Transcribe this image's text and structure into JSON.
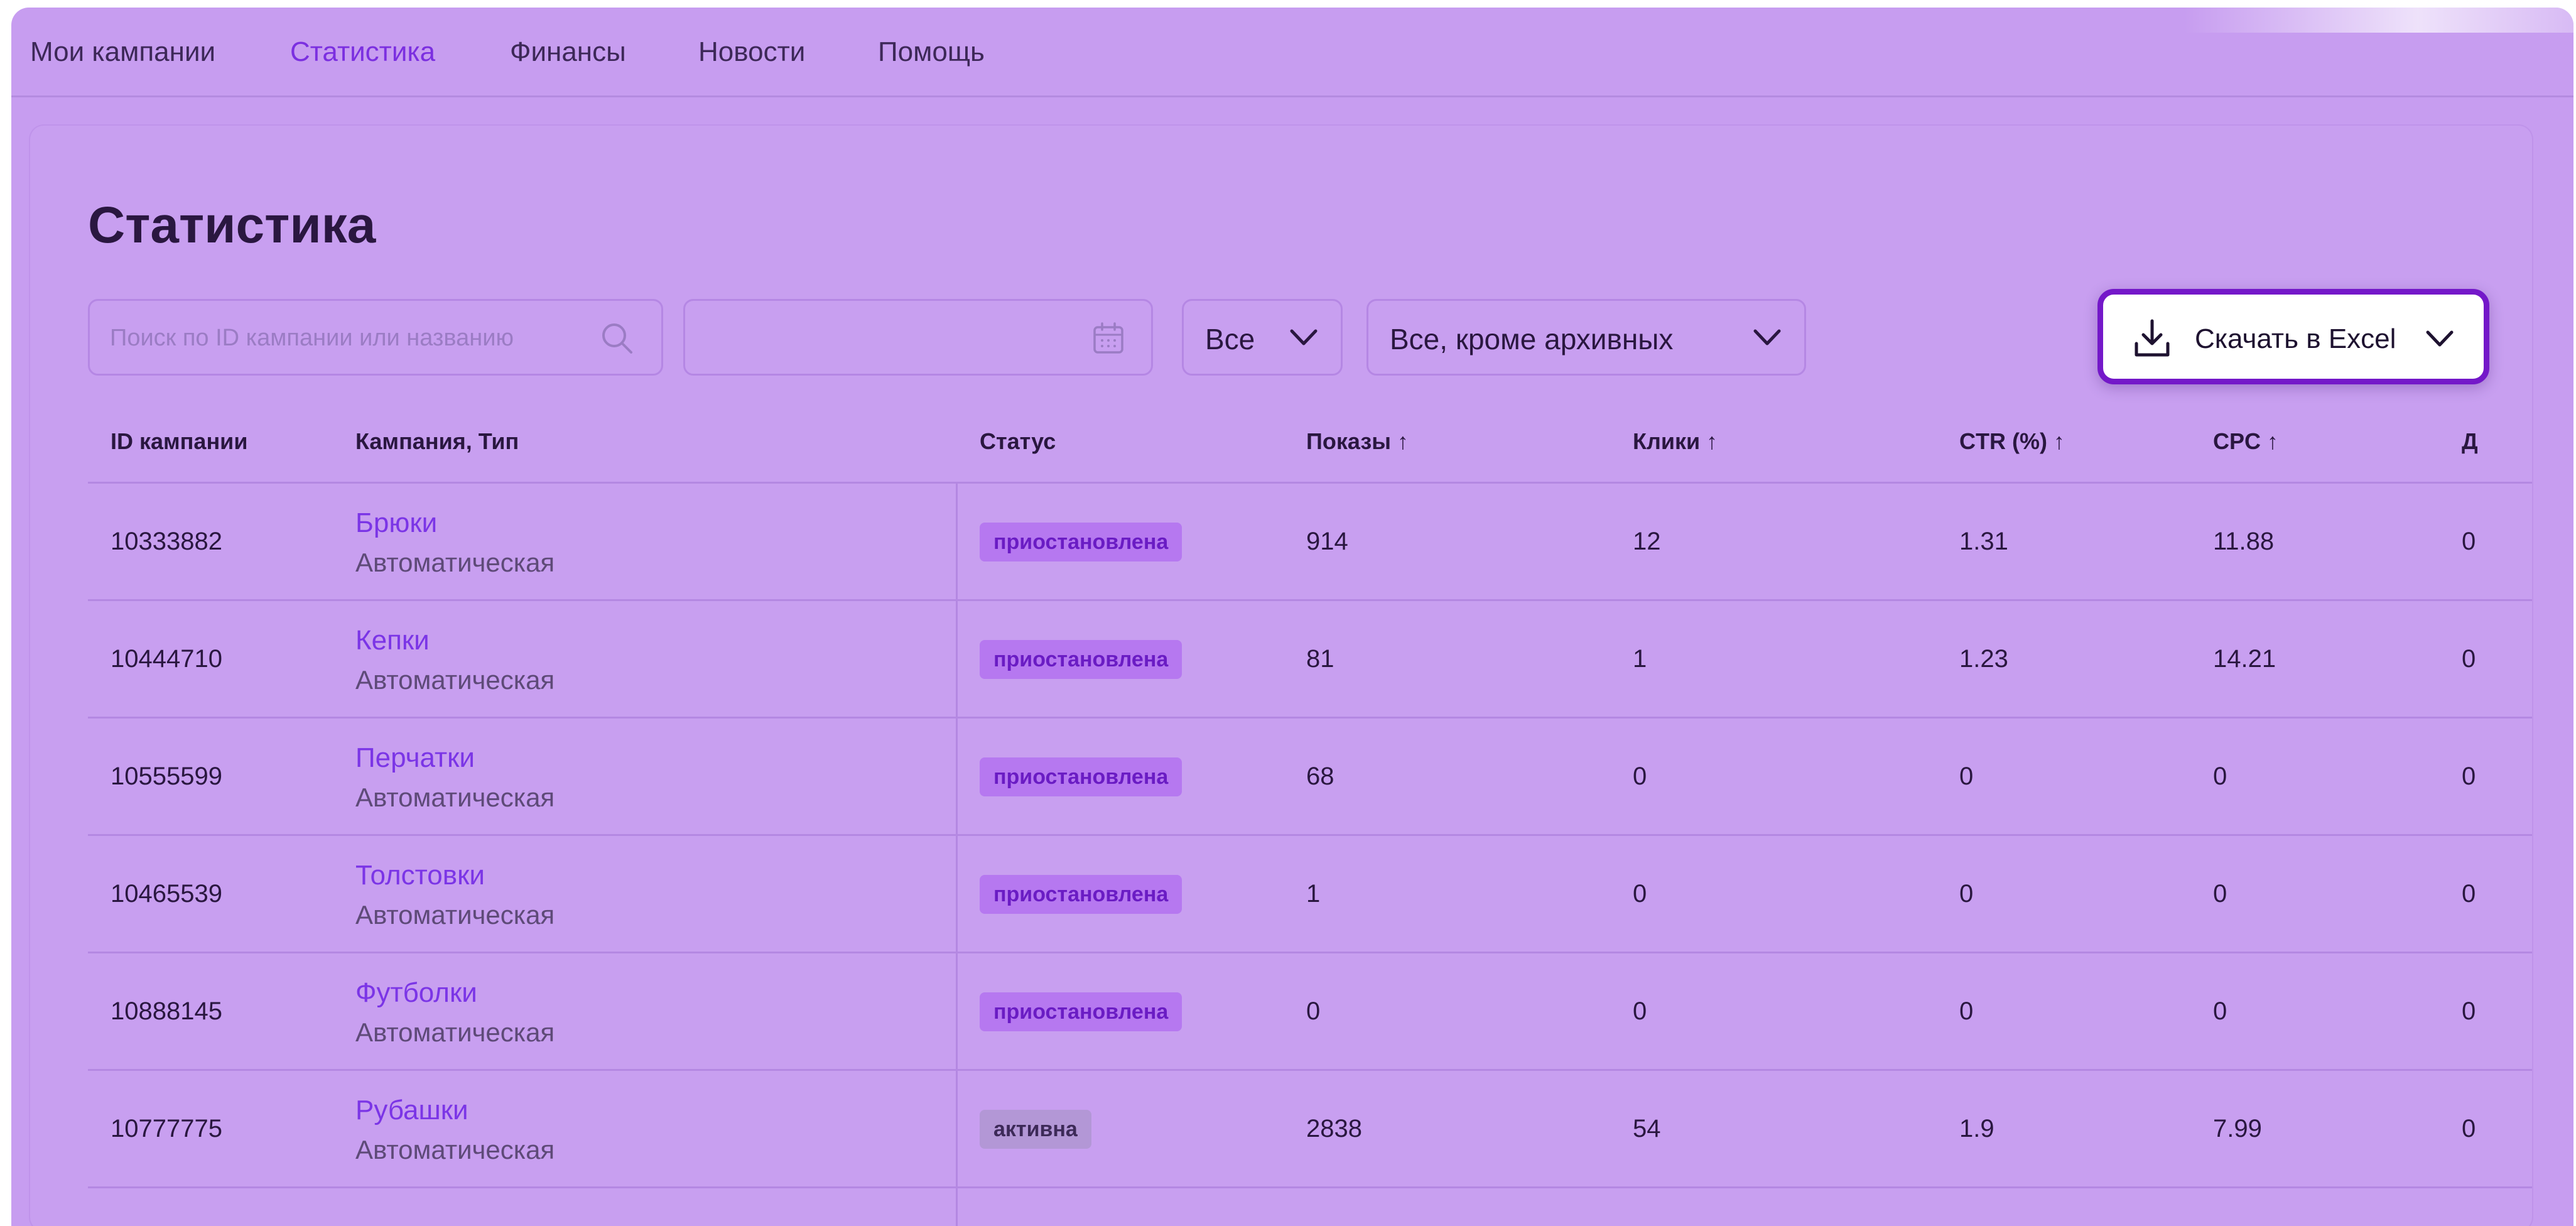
{
  "nav": {
    "items": [
      {
        "label": "Мои кампании",
        "active": false
      },
      {
        "label": "Статистика",
        "active": true
      },
      {
        "label": "Финансы",
        "active": false
      },
      {
        "label": "Новости",
        "active": false
      },
      {
        "label": "Помощь",
        "active": false
      }
    ]
  },
  "page": {
    "title": "Статистика"
  },
  "toolbar": {
    "search_placeholder": "Поиск по ID кампании или названию",
    "date_value": "",
    "type_filter": "Все",
    "status_filter": "Все, кроме архивных",
    "download_label": "Скачать в Excel"
  },
  "table": {
    "columns": [
      "ID кампании",
      "Кампания, Тип",
      "Статус",
      "Показы ↑",
      "Клики ↑",
      "CTR (%) ↑",
      "CPC ↑",
      "Д"
    ],
    "rows": [
      {
        "id": "10333882",
        "name": "Брюки",
        "type": "Автоматическая",
        "status": "приостановлена",
        "status_kind": "paused",
        "shows": "914",
        "clicks": "12",
        "ctr": "1.31",
        "cpc": "11.88",
        "extra": "0"
      },
      {
        "id": "10444710",
        "name": "Кепки",
        "type": "Автоматическая",
        "status": "приостановлена",
        "status_kind": "paused",
        "shows": "81",
        "clicks": "1",
        "ctr": "1.23",
        "cpc": "14.21",
        "extra": "0"
      },
      {
        "id": "10555599",
        "name": "Перчатки",
        "type": "Автоматическая",
        "status": "приостановлена",
        "status_kind": "paused",
        "shows": "68",
        "clicks": "0",
        "ctr": "0",
        "cpc": "0",
        "extra": "0"
      },
      {
        "id": "10465539",
        "name": "Толстовки",
        "type": "Автоматическая",
        "status": "приостановлена",
        "status_kind": "paused",
        "shows": "1",
        "clicks": "0",
        "ctr": "0",
        "cpc": "0",
        "extra": "0"
      },
      {
        "id": "10888145",
        "name": "Футболки",
        "type": "Автоматическая",
        "status": "приостановлена",
        "status_kind": "paused",
        "shows": "0",
        "clicks": "0",
        "ctr": "0",
        "cpc": "0",
        "extra": "0"
      },
      {
        "id": "10777775",
        "name": "Рубашки",
        "type": "Автоматическая",
        "status": "активна",
        "status_kind": "active",
        "shows": "2838",
        "clicks": "54",
        "ctr": "1.9",
        "cpc": "7.99",
        "extra": "0"
      }
    ]
  },
  "colors": {
    "background": "#c79df0",
    "accent": "#7b35e6",
    "button_border": "#7418c9"
  },
  "icons": [
    "search-icon",
    "calendar-icon",
    "chevron-down-icon",
    "download-icon"
  ]
}
